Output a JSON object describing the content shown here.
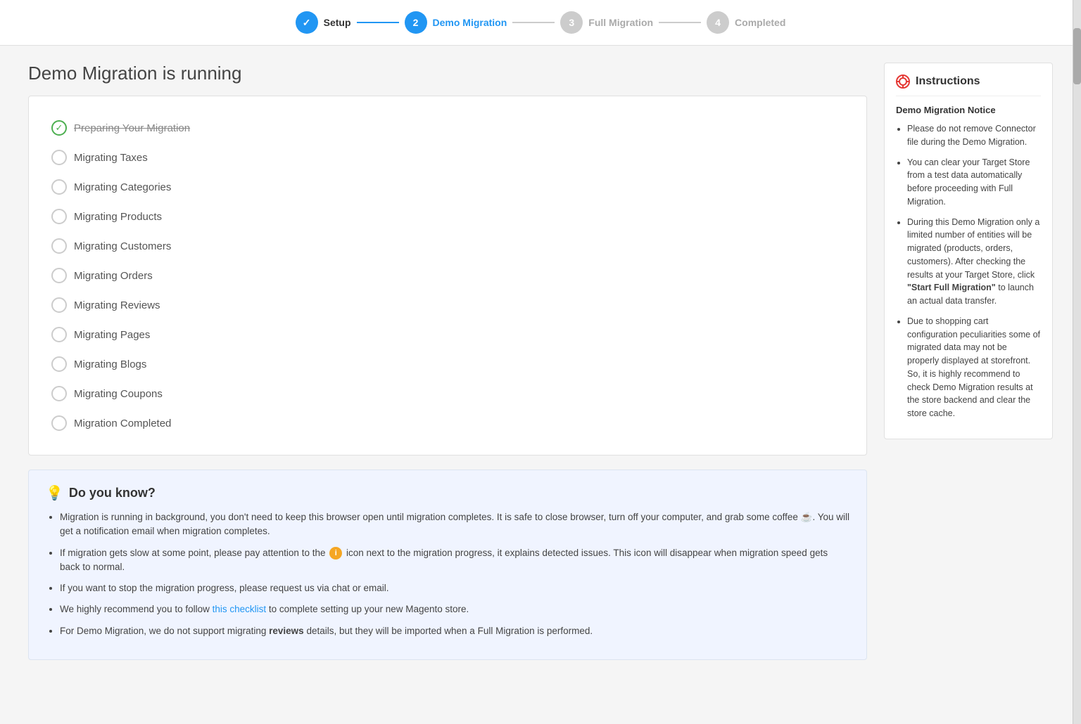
{
  "stepper": {
    "steps": [
      {
        "id": "setup",
        "number": "✓",
        "label": "Setup",
        "state": "completed"
      },
      {
        "id": "demo-migration",
        "number": "2",
        "label": "Demo Migration",
        "state": "active"
      },
      {
        "id": "full-migration",
        "number": "3",
        "label": "Full Migration",
        "state": "inactive"
      },
      {
        "id": "completed",
        "number": "4",
        "label": "Completed",
        "state": "inactive"
      }
    ]
  },
  "page": {
    "title": "Demo Migration is running"
  },
  "migration_steps": [
    {
      "id": "preparing",
      "label": "Preparing Your Migration",
      "state": "done"
    },
    {
      "id": "taxes",
      "label": "Migrating Taxes",
      "state": "pending"
    },
    {
      "id": "categories",
      "label": "Migrating Categories",
      "state": "pending"
    },
    {
      "id": "products",
      "label": "Migrating Products",
      "state": "pending"
    },
    {
      "id": "customers",
      "label": "Migrating Customers",
      "state": "pending"
    },
    {
      "id": "orders",
      "label": "Migrating Orders",
      "state": "pending"
    },
    {
      "id": "reviews",
      "label": "Migrating Reviews",
      "state": "pending"
    },
    {
      "id": "pages",
      "label": "Migrating Pages",
      "state": "pending"
    },
    {
      "id": "blogs",
      "label": "Migrating Blogs",
      "state": "pending"
    },
    {
      "id": "coupons",
      "label": "Migrating Coupons",
      "state": "pending"
    },
    {
      "id": "completed",
      "label": "Migration Completed",
      "state": "pending"
    }
  ],
  "did_you_know": {
    "title": "Do you know?",
    "items": [
      {
        "id": "item1",
        "text_parts": [
          {
            "type": "text",
            "value": "Migration is running in background, you don't need to keep this browser open until migration completes. It is safe to close browser, turn off your computer, and grab some coffee "
          },
          {
            "type": "emoji",
            "value": "☕"
          },
          {
            "type": "text",
            "value": ". You will get a notification email when migration completes."
          }
        ]
      },
      {
        "id": "item2",
        "text_parts": [
          {
            "type": "text",
            "value": "If migration gets slow at some point, please pay attention to the "
          },
          {
            "type": "info_icon",
            "value": "i"
          },
          {
            "type": "text",
            "value": " icon next to the migration progress, it explains detected issues. This icon will disappear when migration speed gets back to normal."
          }
        ]
      },
      {
        "id": "item3",
        "text": "If you want to stop the migration progress, please request us via chat or email."
      },
      {
        "id": "item4",
        "text_before": "We highly recommend you to follow ",
        "link_text": "this checklist",
        "link_href": "#",
        "text_after": " to complete setting up your new Magento store."
      },
      {
        "id": "item5",
        "text_before": "For Demo Migration, we do not support migrating ",
        "bold_text": "reviews",
        "text_after": " details, but they will be imported when a Full Migration is performed."
      }
    ]
  },
  "instructions": {
    "title": "Instructions",
    "notice_title": "Demo Migration Notice",
    "items": [
      "Please do not remove Connector file during the Demo Migration.",
      "You can clear your Target Store from a test data automatically before proceeding with Full Migration.",
      "During this Demo Migration only a limited number of entities will be migrated (products, orders, customers). After checking the results at your Target Store, click \"Start Full Migration\" to launch an actual data transfer.",
      "Due to shopping cart configuration peculiarities some of migrated data may not be properly displayed at storefront. So, it is highly recommend to check Demo Migration results at the store backend and clear the store cache."
    ]
  }
}
